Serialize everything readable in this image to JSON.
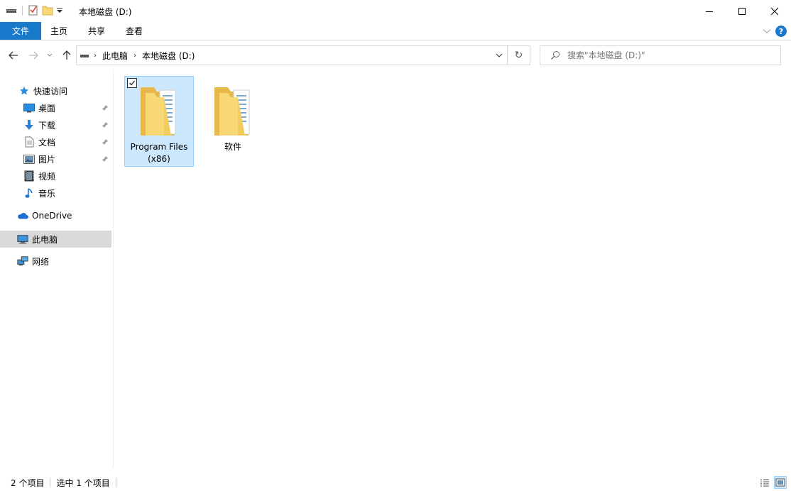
{
  "window": {
    "title": "本地磁盘 (D:)",
    "minimize_icon": "minimize-icon",
    "maximize_icon": "maximize-icon",
    "close_icon": "close-icon"
  },
  "ribbon": {
    "tabs": [
      {
        "label": "文件",
        "active": true
      },
      {
        "label": "主页"
      },
      {
        "label": "共享"
      },
      {
        "label": "查看"
      }
    ],
    "help_label": "?"
  },
  "address": {
    "crumbs": [
      "此电脑",
      "本地磁盘 (D:)"
    ],
    "search_placeholder": "搜索\"本地磁盘 (D:)\""
  },
  "sidebar": {
    "quick_access": "快速访问",
    "quick_items": [
      {
        "label": "桌面",
        "icon": "desktop-icon",
        "pinned": true
      },
      {
        "label": "下载",
        "icon": "download-icon",
        "pinned": true
      },
      {
        "label": "文档",
        "icon": "document-icon",
        "pinned": true
      },
      {
        "label": "图片",
        "icon": "pictures-icon",
        "pinned": true
      },
      {
        "label": "视频",
        "icon": "videos-icon",
        "pinned": false
      },
      {
        "label": "音乐",
        "icon": "music-icon",
        "pinned": false
      }
    ],
    "onedrive": "OneDrive",
    "this_pc": "此电脑",
    "network": "网络"
  },
  "files": [
    {
      "name": "Program Files (x86)",
      "icon": "folder-icon",
      "selected": true
    },
    {
      "name": "软件",
      "icon": "folder-icon",
      "selected": false
    }
  ],
  "status": {
    "count": "2 个项目",
    "selection": "选中 1 个项目"
  },
  "colors": {
    "accent": "#1979ca",
    "selection_bg": "#cce8ff",
    "selection_border": "#99d1ff",
    "folder": "#f8d775"
  }
}
